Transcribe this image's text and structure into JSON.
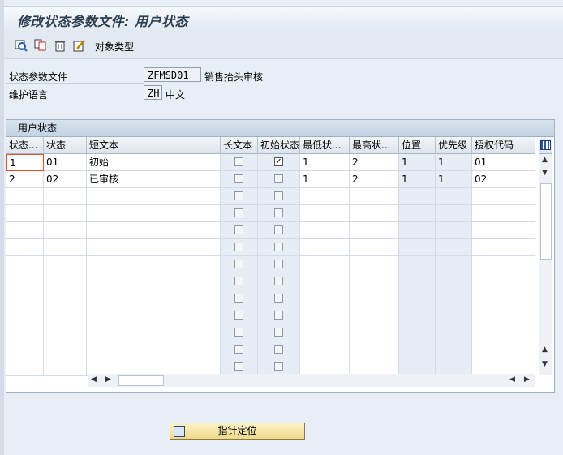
{
  "window": {
    "title": "修改状态参数文件: 用户状态"
  },
  "toolbar": {
    "icons": [
      "display-icon",
      "copy-icon",
      "delete-icon",
      "edit-icon"
    ],
    "object_types_label": "对象类型"
  },
  "form": {
    "status_profile_label": "状态参数文件",
    "status_profile_value": "ZFMSD01",
    "status_profile_desc": "销售抬头审核",
    "language_label": "维护语言",
    "language_value": "ZH",
    "language_desc": "中文"
  },
  "table": {
    "title": "用户状态",
    "columns": [
      "状态...",
      "状态",
      "短文本",
      "长文本",
      "初始状态",
      "最低状...",
      "最高状...",
      "位置",
      "优先级",
      "授权代码"
    ],
    "rows": [
      {
        "num": "1",
        "status": "01",
        "text": "初始",
        "long_text": false,
        "initial": true,
        "low": "1",
        "high": "2",
        "pos": "1",
        "prio": "1",
        "auth": "01"
      },
      {
        "num": "2",
        "status": "02",
        "text": "已审核",
        "long_text": false,
        "initial": false,
        "low": "1",
        "high": "2",
        "pos": "1",
        "prio": "1",
        "auth": "02"
      }
    ],
    "empty_rows": 11
  },
  "footer": {
    "button_label": "指针定位"
  }
}
